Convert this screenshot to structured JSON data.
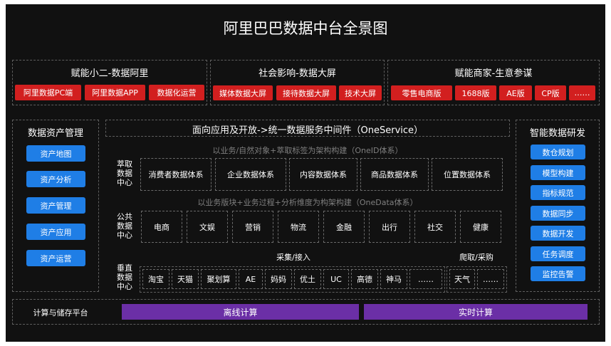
{
  "title": "阿里巴巴数据中台全景图",
  "top_sections": [
    {
      "title": "赋能小二-数据阿里",
      "items": [
        "阿里数据PC端",
        "阿里数据APP",
        "数据化运营"
      ]
    },
    {
      "title": "社会影响-数据大屏",
      "items": [
        "媒体数据大屏",
        "接待数据大屏",
        "技术大屏"
      ]
    },
    {
      "title": "赋能商家-生意参谋",
      "items": [
        "零售电商版",
        "1688版",
        "AE版",
        "CP版",
        "……"
      ]
    }
  ],
  "left": {
    "title": "数据资产管理",
    "items": [
      "资产地图",
      "资产分析",
      "资产管理",
      "资产应用",
      "资产运营"
    ]
  },
  "right": {
    "title": "智能数据研发",
    "items": [
      "数仓规划",
      "模型构建",
      "指标规范",
      "数据同步",
      "数据开发",
      "任务调度",
      "监控告警"
    ]
  },
  "center": {
    "header": "面向应用及开放->统一数据服务中间件（OneService）",
    "extract": {
      "subtitle": "以业务/自然对象+萃取标签为架构构建（OneID体系）",
      "label_lines": [
        "萃取",
        "数据",
        "中心"
      ],
      "items": [
        "消费者数据体系",
        "企业数据体系",
        "内容数据体系",
        "商品数据体系",
        "位置数据体系"
      ]
    },
    "public": {
      "subtitle": "以业务版块+业务过程+分析维度为构架构建（OneData体系）",
      "label_lines": [
        "公共",
        "数据",
        "中心"
      ],
      "items": [
        "电商",
        "文娱",
        "营销",
        "物流",
        "金融",
        "出行",
        "社交",
        "健康"
      ]
    },
    "vertical": {
      "label_lines": [
        "垂直",
        "数据",
        "中心"
      ],
      "collect_label": "采集/接入",
      "crawl_label": "爬取/采购",
      "collect_items": [
        "淘宝",
        "天猫",
        "聚划算",
        "AE",
        "妈妈",
        "优土",
        "UC",
        "高德",
        "神马",
        "……"
      ],
      "crawl_items": [
        "天气",
        "……"
      ]
    }
  },
  "bottom": {
    "label": "计算与储存平台",
    "offline": "离线计算",
    "realtime": "实时计算"
  },
  "colors": {
    "red": "#d21f1f",
    "blue": "#1f7ee6",
    "purple": "#6b2fa6",
    "background": "#111111"
  }
}
